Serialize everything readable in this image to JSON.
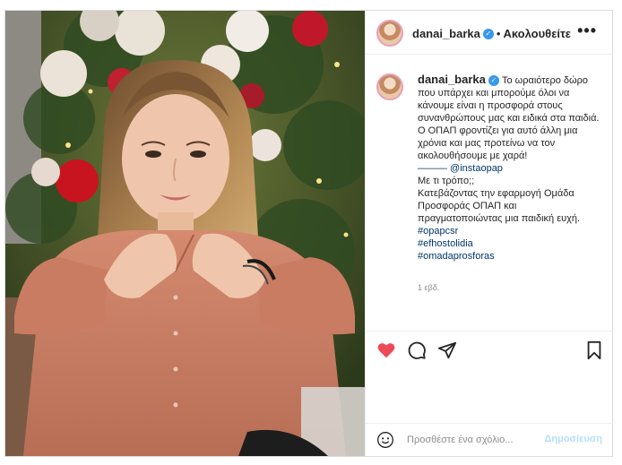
{
  "post": {
    "username": "danai_barka",
    "follow_status": "Ακολουθείτε",
    "caption_lines": [
      "Το ωραιότερο δώρο που υπάρχει και μπορούμε όλοι να κάνουμε είναι η προσφορά στους συνανθρώπους μας και ειδικά στα παιδιά. Ο ΟΠΑΠ φροντίζει για αυτό άλλη μια χρόνια και μας προτείνω να τον ακολουθήσουμε με χαρά!",
      "——— @instaopap",
      "Με τι τρόπο;;",
      "Κατεβάζοντας την εφαρμογή Ομάδα Προσφοράς ΟΠΑΠ και πραγματοποιώντας μια παιδική ευχή."
    ],
    "hashtags": [
      "#opapcsr",
      "#efhostolidia",
      "#omadaprosforas"
    ],
    "time_ago": "1 εβδ."
  },
  "comment": {
    "placeholder": "Προσθέστε ένα σχόλιο...",
    "post_label": "Δημοσίευση"
  },
  "colors": {
    "like_red": "#ed4956",
    "link_blue": "#00376b",
    "verified_blue": "#3897f0",
    "post_disabled": "#b2dffc"
  },
  "icons": [
    "verified-badge-icon",
    "more-options-icon",
    "heart-icon",
    "comment-icon",
    "share-icon",
    "bookmark-icon",
    "emoji-icon"
  ]
}
